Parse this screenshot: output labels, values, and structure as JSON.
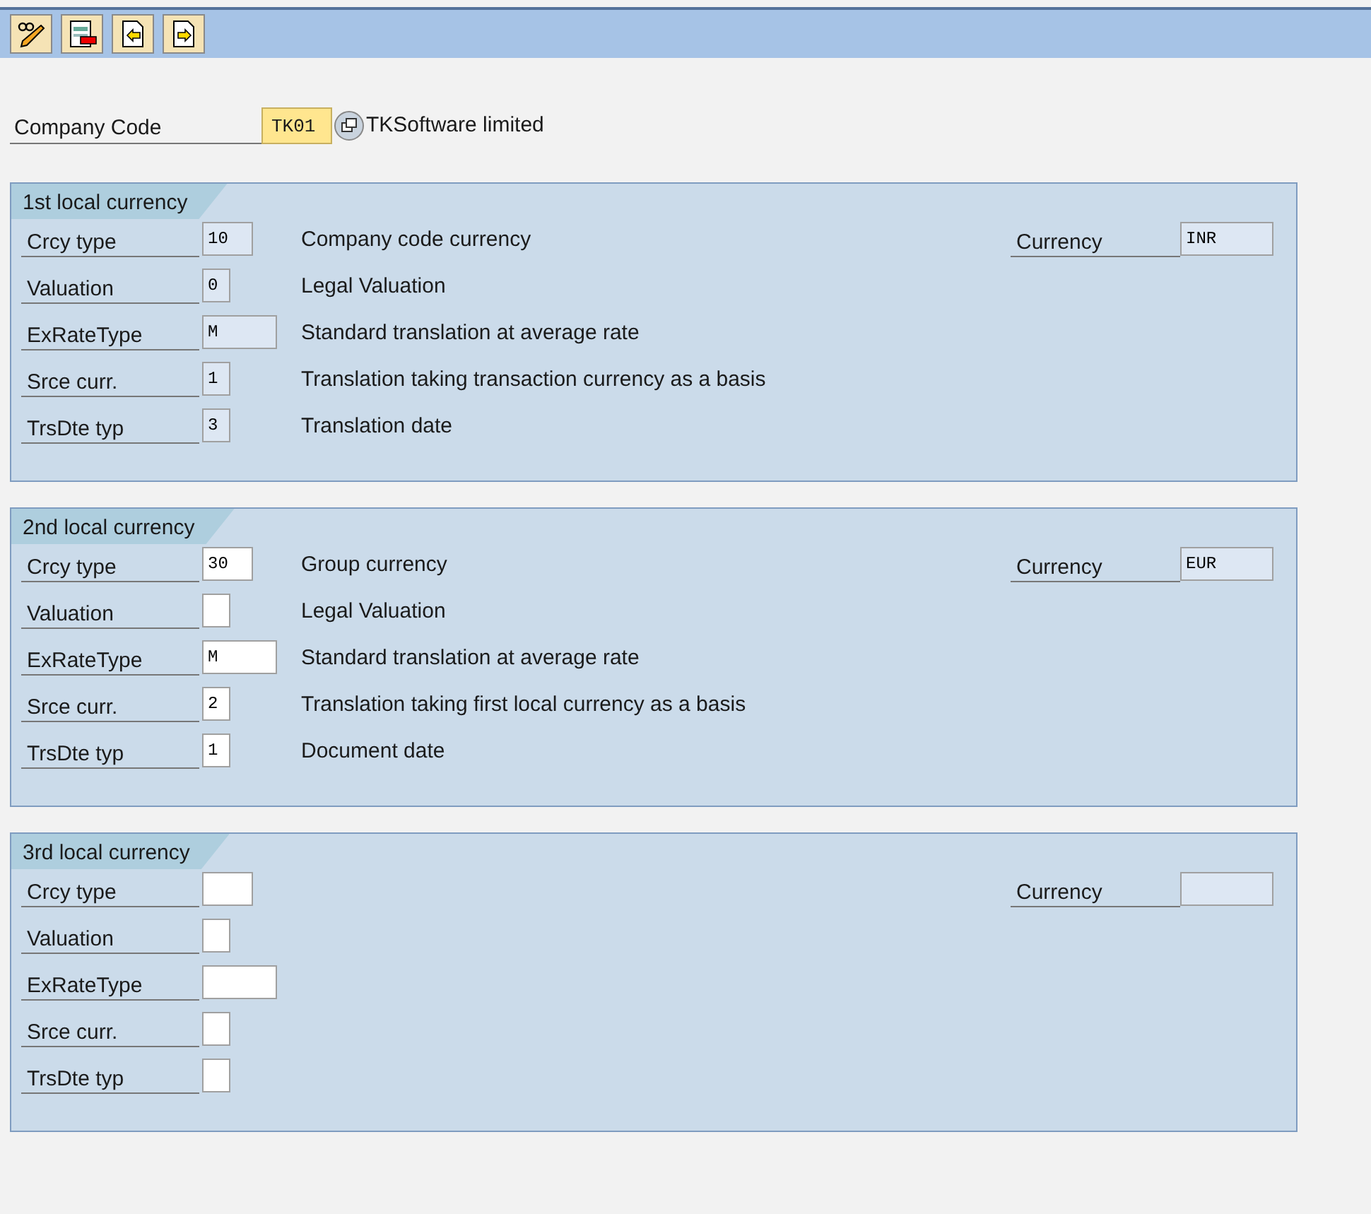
{
  "toolbar": {
    "buttons": [
      {
        "kind": "glasses-pencil"
      },
      {
        "kind": "form-remove"
      },
      {
        "kind": "page-left"
      },
      {
        "kind": "page-right"
      }
    ]
  },
  "company_code": {
    "label": "Company Code",
    "value": "TK01",
    "name": "TKSoftware limited"
  },
  "sections": [
    {
      "title": "1st local currency",
      "currency": {
        "label": "Currency",
        "value": "INR",
        "editable": false
      },
      "rows": [
        {
          "label": "Crcy type",
          "value": "10",
          "editable": false,
          "description": "Company code currency"
        },
        {
          "label": "Valuation",
          "value": "0",
          "editable": false,
          "description": "Legal Valuation"
        },
        {
          "label": "ExRateType",
          "value": "M",
          "editable": false,
          "description": "Standard translation at average rate"
        },
        {
          "label": "Srce curr.",
          "value": "1",
          "editable": false,
          "description": "Translation taking transaction currency as a basis"
        },
        {
          "label": "TrsDte typ",
          "value": "3",
          "editable": false,
          "description": "Translation date"
        }
      ]
    },
    {
      "title": "2nd local currency",
      "currency": {
        "label": "Currency",
        "value": "EUR",
        "editable": false
      },
      "rows": [
        {
          "label": "Crcy type",
          "value": "30",
          "editable": true,
          "description": "Group currency"
        },
        {
          "label": "Valuation",
          "editable": true,
          "description": "Legal Valuation"
        },
        {
          "label": "ExRateType",
          "value": "M",
          "editable": true,
          "description": "Standard translation at average rate"
        },
        {
          "label": "Srce curr.",
          "value": "2",
          "editable": true,
          "description": "Translation taking first local currency as a basis"
        },
        {
          "label": "TrsDte typ",
          "value": "1",
          "editable": true,
          "description": "Document date"
        }
      ]
    },
    {
      "title": "3rd local currency",
      "currency": {
        "label": "Currency",
        "editable": false
      },
      "rows": [
        {
          "label": "Crcy type",
          "editable": true
        },
        {
          "label": "Valuation",
          "editable": true
        },
        {
          "label": "ExRateType",
          "editable": true
        },
        {
          "label": "Srce curr.",
          "editable": true
        },
        {
          "label": "TrsDte typ",
          "editable": true
        }
      ]
    }
  ]
}
